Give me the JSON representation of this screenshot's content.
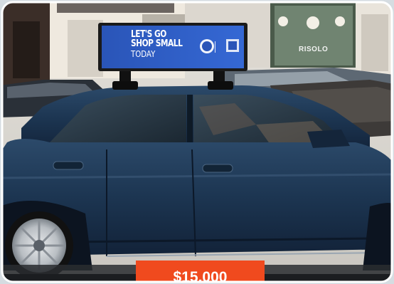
{
  "sign": {
    "line1": "LET'S GO",
    "line2": "SHOP SMALL",
    "line3": "TODAY"
  },
  "storefront": {
    "name": "RISOLO"
  },
  "price": {
    "label": "$15,000"
  },
  "colors": {
    "car_body": "#1f3a55",
    "sign_screen": "#2f5fc4",
    "price_tag": "#f04a1e",
    "card_border": "#ffffff"
  }
}
